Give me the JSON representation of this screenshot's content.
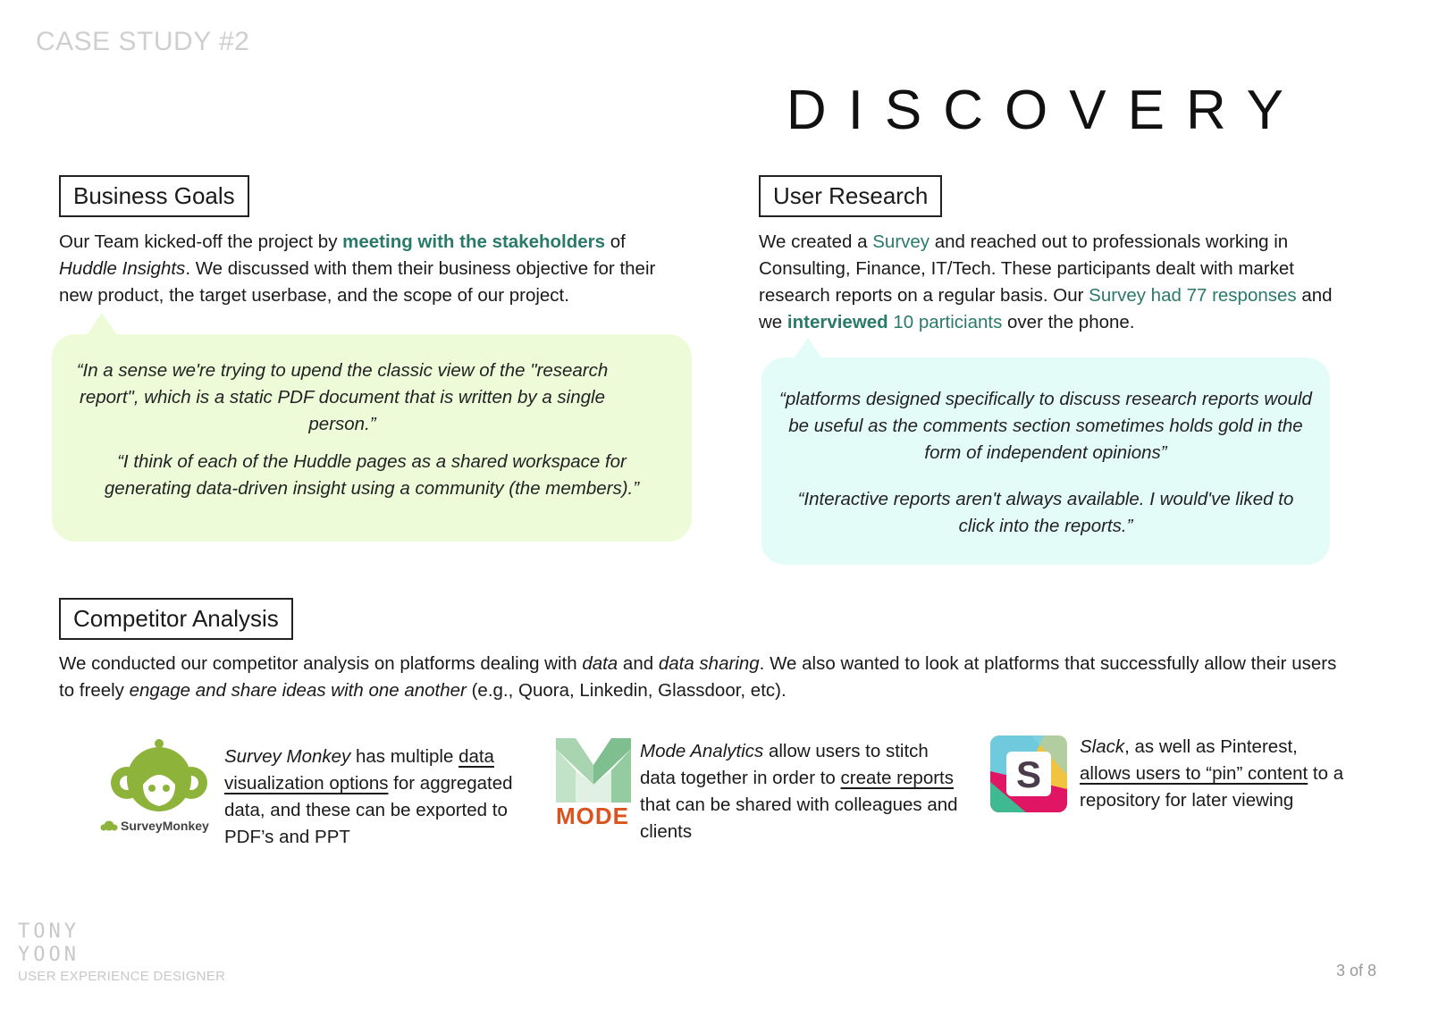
{
  "header": {
    "case_label": "CASE STUDY #2",
    "title": "DISCOVERY"
  },
  "business_goals": {
    "heading": "Business Goals",
    "text_1": "Our Team kicked-off the project by ",
    "highlight": "meeting with the stakeholders",
    "text_2": " of ",
    "company": "Huddle Insights",
    "text_3": ". We discussed with them their business objective for their new product, the target userbase, and the scope of our project.",
    "quote_1": "“In a sense we're trying to upend the classic view of the \"research report\", which is a static PDF document that is written by a single person.”",
    "quote_2": "“I think of each of the Huddle pages as a shared workspace for generating data-driven insight using a community (the members).”"
  },
  "user_research": {
    "heading": "User Research",
    "text_1": "We created a ",
    "survey": "Survey",
    "text_2": " and reached out to professionals working in Consulting, Finance, IT/Tech. These participants dealt with market research reports on a regular basis. Our ",
    "survey_responses": "Survey had 77 responses",
    "text_3": " and we ",
    "interviewed": "interviewed",
    "participants": " 10 particiants",
    "text_4": " over the phone.",
    "quote_1": "“platforms designed specifically to discuss research reports would be useful as the comments section sometimes holds gold in the form of independent opinions”",
    "quote_2": "“Interactive reports aren't always available. I would've liked to click into the reports.”"
  },
  "competitor_analysis": {
    "heading": "Competitor Analysis",
    "text_1": "We conducted our competitor analysis on platforms dealing with ",
    "data": "data",
    "text_2": " and ",
    "data_sharing": "data sharing",
    "text_3": ". We also wanted to look at platforms that successfully allow their users to freely ",
    "engage": "engage and share ideas with one another",
    "text_4": " (e.g., Quora, Linkedin, Glassdoor, etc).",
    "competitors": [
      {
        "logo_text": "SurveyMonkey",
        "name": "Survey Monkey",
        "t1": " has multiple ",
        "link": "data visualization options",
        "t2": " for aggregated data, and these can be exported to PDF’s and PPT"
      },
      {
        "logo_text": "MODE",
        "name": "Mode Analytics",
        "t1": " allow users to stitch data together in order to ",
        "link": "create reports",
        "t2": " that can be shared with colleagues and clients"
      },
      {
        "logo_text": "S",
        "name": "Slack",
        "t1": ", as well as Pinterest, ",
        "link": "allows users to “pin” content",
        "t2": " to a repository for later viewing"
      }
    ]
  },
  "footer": {
    "name_line_1": "TONY",
    "name_line_2": "YOON",
    "role": "USER EXPERIENCE DESIGNER",
    "page": "3 of 8"
  },
  "colors": {
    "highlight": "#2a7a6a",
    "bubble_green": "#eefbd9",
    "bubble_cyan": "#e4fcf7",
    "monkey_green": "#8db33a",
    "mode_orange": "#d9541e"
  }
}
